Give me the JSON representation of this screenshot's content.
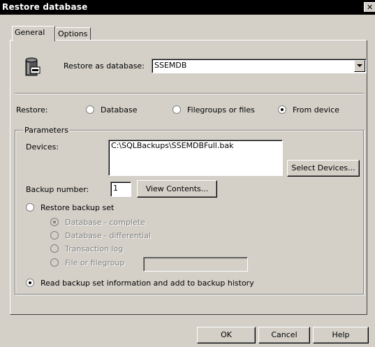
{
  "window": {
    "title": "Restore database",
    "close_glyph": "✕"
  },
  "tabs": [
    {
      "label": "General",
      "active": true
    },
    {
      "label": "Options",
      "active": false
    }
  ],
  "header": {
    "restore_as_label": "Restore as database:",
    "restore_as_value": "SSEMDB",
    "icon": "database-restore-icon"
  },
  "restore": {
    "label": "Restore:",
    "options": [
      {
        "label": "Database",
        "checked": false
      },
      {
        "label": "Filegroups or files",
        "checked": false
      },
      {
        "label": "From device",
        "checked": true
      }
    ]
  },
  "parameters": {
    "group_label": "Parameters",
    "devices_label": "Devices:",
    "devices_list": [
      "C:\\SQLBackups\\SSEMDBFull.bak"
    ],
    "select_devices_button": "Select Devices...",
    "backup_number_label": "Backup number:",
    "backup_number_value": "1",
    "view_contents_button": "View Contents...",
    "restore_backup_set": {
      "label": "Restore backup set",
      "checked": false
    },
    "backup_set_options": [
      {
        "label": "Database - complete",
        "checked": true
      },
      {
        "label": "Database - differential",
        "checked": false
      },
      {
        "label": "Transaction log",
        "checked": false
      },
      {
        "label": "File or filegroup",
        "checked": false
      }
    ],
    "file_or_filegroup_value": "",
    "read_backup_info": {
      "label": "Read backup set information and add to backup history",
      "checked": true
    }
  },
  "footer": {
    "ok": "OK",
    "cancel": "Cancel",
    "help": "Help"
  }
}
